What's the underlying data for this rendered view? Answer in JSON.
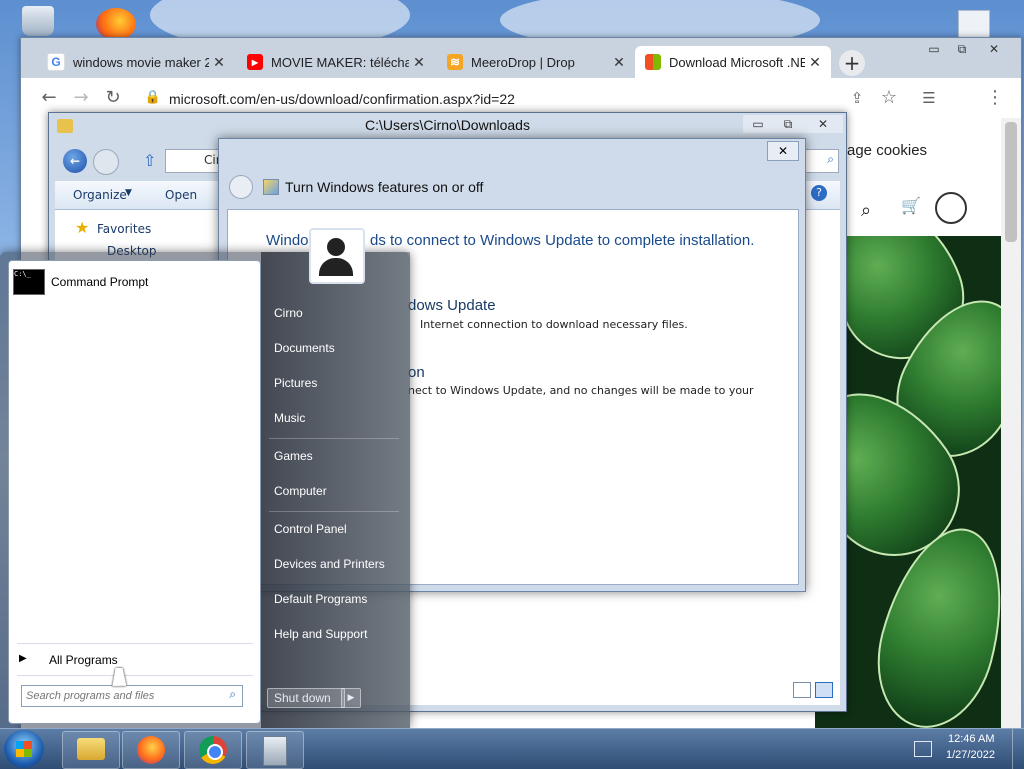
{
  "chrome": {
    "tabs": [
      {
        "title": "windows movie maker 2",
        "favicon": "google-g-icon"
      },
      {
        "title": "MOVIE MAKER: télécharg",
        "favicon": "youtube-icon"
      },
      {
        "title": "MeeroDrop | Drop",
        "favicon": "meerodrop-icon"
      },
      {
        "title": "Download Microsoft .NE",
        "favicon": "microsoft-logo-icon"
      }
    ],
    "new_tab": "+",
    "url": "microsoft.com/en-us/download/confirmation.aspx?id=22",
    "page": {
      "manage_cookies": "age cookies"
    }
  },
  "explorer": {
    "title": "C:\\Users\\Cirno\\Downloads",
    "address": "Cir",
    "toolbar": {
      "organize": "Organize",
      "open": "Open"
    },
    "nav": {
      "favorites": "Favorites",
      "desktop": "Desktop"
    }
  },
  "features": {
    "title": "Turn Windows features on or off",
    "heading": "Windows needs to connect to Windows Update to complete installation.",
    "heading_visible": [
      "Windo",
      "ds to connect to Windows Update to complete installation."
    ],
    "option1_title": "dows Update",
    "option1_desc": "Internet connection to download necessary files.",
    "option2_title": "on",
    "option2_desc": "nect to Windows Update, and no changes will be made to your"
  },
  "startmenu": {
    "pinned": [
      {
        "label": "Command Prompt",
        "icon": "command-prompt-icon"
      }
    ],
    "all_programs": "All Programs",
    "search_placeholder": "Search programs and files",
    "right_items": {
      "user": "Cirno",
      "documents": "Documents",
      "pictures": "Pictures",
      "music": "Music",
      "games": "Games",
      "computer": "Computer",
      "control_panel": "Control Panel",
      "devices": "Devices and Printers",
      "default_programs": "Default Programs",
      "help": "Help and Support"
    },
    "shutdown": "Shut down"
  },
  "taskbar": {
    "time": "12:46 AM",
    "date": "1/27/2022",
    "items": [
      "explorer-icon",
      "firefox-icon",
      "chrome-icon",
      "installer-icon"
    ]
  }
}
